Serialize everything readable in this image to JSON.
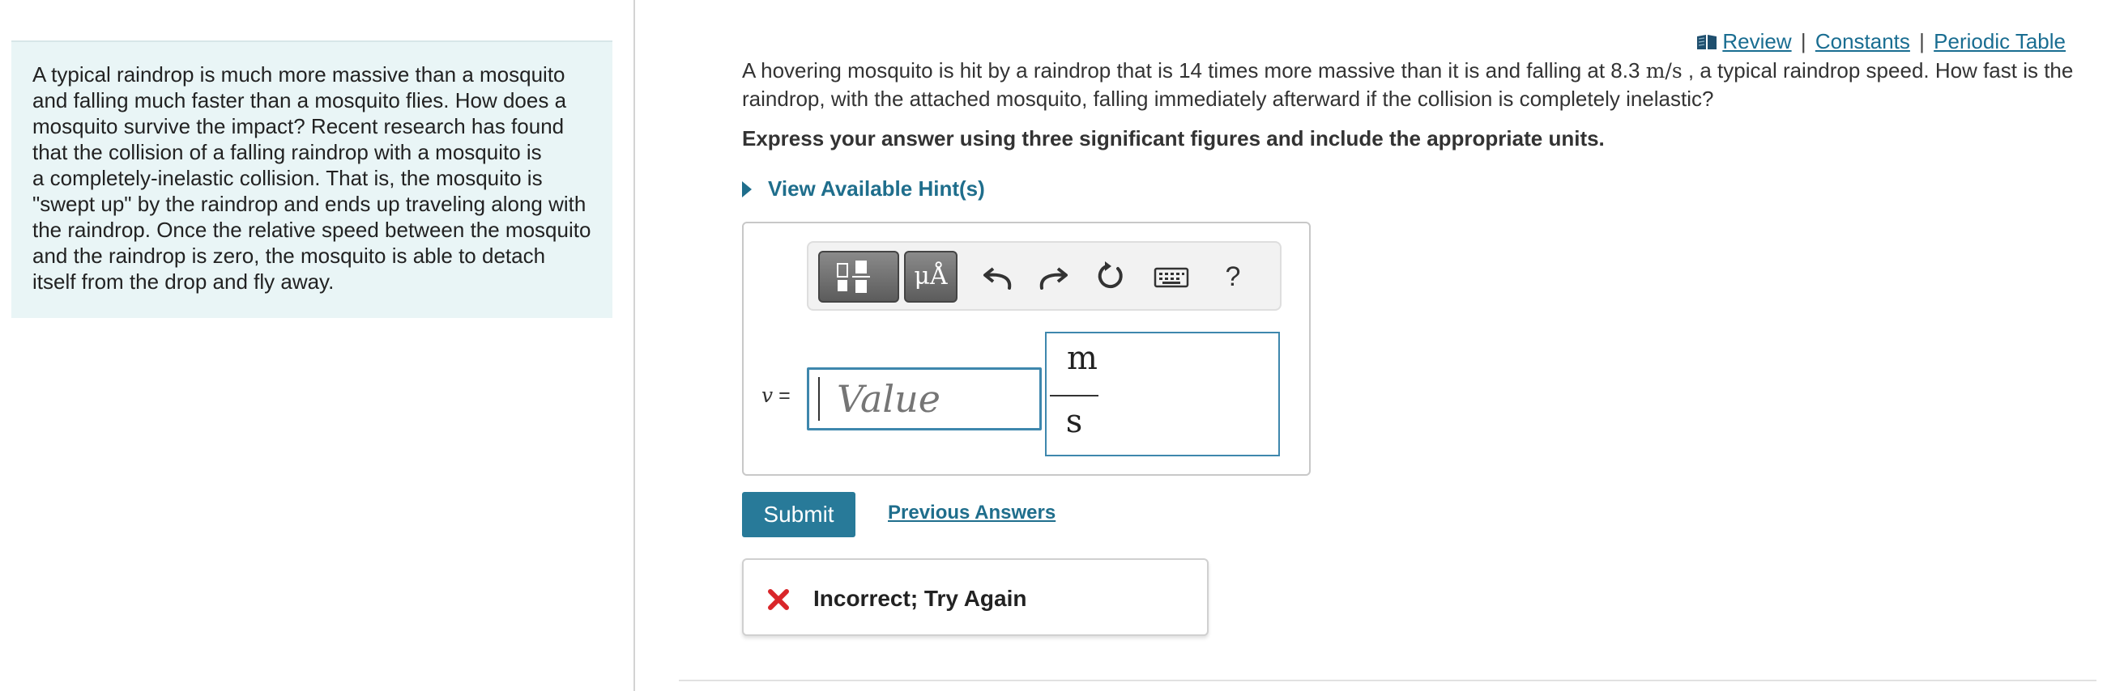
{
  "intro": {
    "lines": [
      "A typical raindrop is much more massive than a mosquito",
      "and falling much faster than a mosquito flies.  How does a",
      "mosquito survive the impact? Recent research has found",
      "that the collision of a falling raindrop with a mosquito is",
      "a completely-inelastic collision. That is, the mosquito is",
      "\"swept up\" by the raindrop and ends up traveling along with",
      "the raindrop. Once the relative speed between the mosquito",
      "and the raindrop is zero, the mosquito is able to detach",
      "itself from the drop and fly away."
    ]
  },
  "links": {
    "review": "Review",
    "constants": "Constants",
    "periodic_table": "Periodic Table",
    "separator": "|"
  },
  "question": {
    "part1": "A hovering mosquito is hit by a raindrop that is 14 times more massive than it is and falling at 8.3",
    "speed_unit": "m/s",
    "part2": ", a typical raindrop speed. How fast is the raindrop, with the attached mosquito, falling immediately afterward if the collision is completely inelastic?",
    "instruction": "Express your answer using three significant figures and include the appropriate units."
  },
  "hint": {
    "label": "View Available Hint(s)"
  },
  "answer": {
    "variable": "v",
    "equals": "=",
    "value_placeholder": "Value",
    "unit_numerator": "m",
    "unit_denominator": "s"
  },
  "toolbar": {
    "units_symbol": "μÅ",
    "help": "?",
    "icons": [
      "templates-icon",
      "units-icon",
      "undo-icon",
      "redo-icon",
      "reset-icon",
      "keyboard-icon",
      "help-icon"
    ]
  },
  "buttons": {
    "submit": "Submit",
    "previous_answers": "Previous Answers"
  },
  "feedback": {
    "message": "Incorrect; Try Again"
  },
  "colors": {
    "accent": "#287a99",
    "link": "#196d91",
    "intro_bg": "#e9f5f6",
    "error": "#d9262a",
    "input_border": "#3e87ad"
  }
}
